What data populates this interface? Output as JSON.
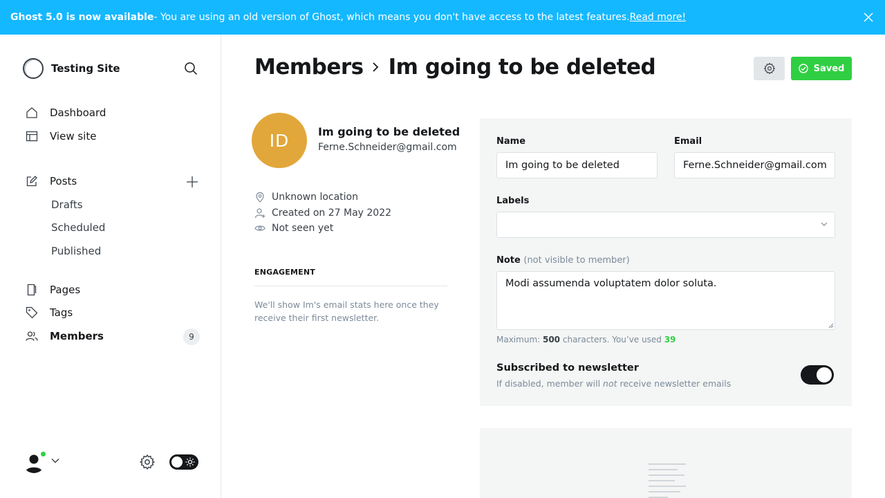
{
  "banner": {
    "title": "Ghost 5.0 is now available",
    "message": " - You are using an old version of Ghost, which means you don't have access to the latest features. ",
    "link": "Read more!"
  },
  "sidebar": {
    "site_name": "Testing Site",
    "nav": {
      "dashboard": "Dashboard",
      "view_site": "View site",
      "posts": "Posts",
      "drafts": "Drafts",
      "scheduled": "Scheduled",
      "published": "Published",
      "pages": "Pages",
      "tags": "Tags",
      "members": "Members",
      "members_count": "9"
    }
  },
  "header": {
    "crumb_parent": "Members",
    "crumb_current": "Im going to be deleted",
    "saved_label": "Saved"
  },
  "member": {
    "initials": "ID",
    "name": "Im going to be deleted",
    "email": "Ferne.Schneider@gmail.com",
    "location": "Unknown location",
    "created": "Created on 27 May 2022",
    "seen": "Not seen yet"
  },
  "engagement": {
    "title": "ENGAGEMENT",
    "text": "We'll show Im's email stats here once they receive their first newsletter."
  },
  "form": {
    "name_label": "Name",
    "name_value": "Im going to be deleted",
    "email_label": "Email",
    "email_value": "Ferne.Schneider@gmail.com",
    "labels_label": "Labels",
    "labels_value": "",
    "note_label": "Note",
    "note_hint": "(not visible to member)",
    "note_value": "Modi assumenda voluptatem dolor soluta.",
    "counter_prefix": "Maximum: ",
    "counter_max": "500",
    "counter_mid": " characters. You’ve used ",
    "counter_used": "39",
    "subscribed_title": "Subscribed to newsletter",
    "subscribed_desc_1": "If disabled, member will ",
    "subscribed_desc_em": "not",
    "subscribed_desc_2": " receive newsletter emails",
    "subscribed": true
  },
  "colors": {
    "banner": "#14b8ff",
    "saved": "#30cf43",
    "avatar": "#e2a73a"
  }
}
